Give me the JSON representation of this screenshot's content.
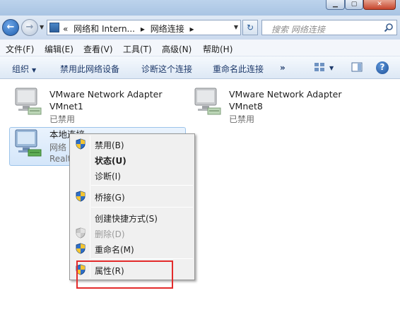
{
  "navigation": {
    "breadcrumb": [
      "«",
      "网络和 Intern...",
      "▸",
      "网络连接",
      "▸"
    ],
    "search_placeholder": "搜索 网络连接"
  },
  "menu": {
    "items": [
      "文件(F)",
      "编辑(E)",
      "查看(V)",
      "工具(T)",
      "高级(N)",
      "帮助(H)"
    ]
  },
  "commands": {
    "organize": "组织",
    "disable_device": "禁用此网络设备",
    "diagnose": "诊断这个连接",
    "rename": "重命名此连接",
    "more": "»"
  },
  "adapters": [
    {
      "name_line1": "VMware Network Adapter",
      "name_line2": "VMnet1",
      "status": "已禁用"
    },
    {
      "name_line1": "VMware Network Adapter",
      "name_line2": "VMnet8",
      "status": "已禁用"
    },
    {
      "name_line1": "本地连接",
      "name_line2": "网络",
      "status": "Realt"
    }
  ],
  "context_menu": {
    "items": [
      {
        "label": "禁用(B)",
        "shield": true
      },
      {
        "label": "状态(U)",
        "bold": true
      },
      {
        "label": "诊断(I)"
      },
      {
        "label": "桥接(G)",
        "shield": true
      },
      {
        "label": "创建快捷方式(S)"
      },
      {
        "label": "删除(D)",
        "shield": true,
        "disabled": true
      },
      {
        "label": "重命名(M)",
        "shield": true
      },
      {
        "label": "属性(R)",
        "shield": true
      }
    ]
  },
  "colors": {
    "highlight_border": "#e32b2b",
    "selection_fill": "#d4e6fa",
    "command_text": "#1e3a6b"
  }
}
